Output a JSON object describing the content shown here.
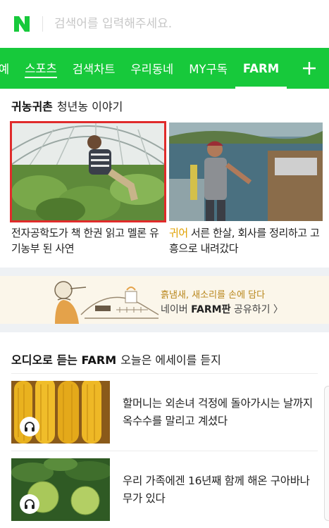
{
  "header": {
    "logo_letter": "N",
    "brand_color": "#17c93b",
    "search_placeholder": "검색어를 입력해주세요."
  },
  "tabs": [
    {
      "label": "예",
      "state": "partial"
    },
    {
      "label": "스포츠",
      "state": "underlined"
    },
    {
      "label": "검색차트",
      "state": "normal"
    },
    {
      "label": "우리동네",
      "state": "normal"
    },
    {
      "label": "MY구독",
      "state": "normal"
    },
    {
      "label": "FARM",
      "state": "active"
    }
  ],
  "tab_plus_icon": "plus-icon",
  "farm_section": {
    "title": "귀농귀촌",
    "subtitle": "청년농 이야기",
    "cards": [
      {
        "caption": "전자공학도가 책 한권 읽고 멜론 유기농부 된 사연",
        "keyword": "",
        "selected": true
      },
      {
        "caption": "서른 한살, 회사를 정리하고 고흥으로 내려갔다",
        "keyword": "귀어",
        "selected": false
      }
    ]
  },
  "banner": {
    "line1": "흙냄새, 새소리를 손에 담다",
    "line2_prefix": "네이버 ",
    "line2_bold": "FARM판",
    "line2_suffix": " 공유하기 〉"
  },
  "audio_section": {
    "title": "오디오로 듣는 FARM",
    "subtitle": "오늘은 에세이를 듣지",
    "items": [
      {
        "text": "할머니는 외손녀 걱정에 돌아가시는 날까지 옥수수를 말리고 계셨다",
        "icon": "headphones-icon"
      },
      {
        "text": "우리 가족에겐 16년째 함께 해온 구아바나무가 있다",
        "icon": "headphones-icon"
      }
    ]
  }
}
